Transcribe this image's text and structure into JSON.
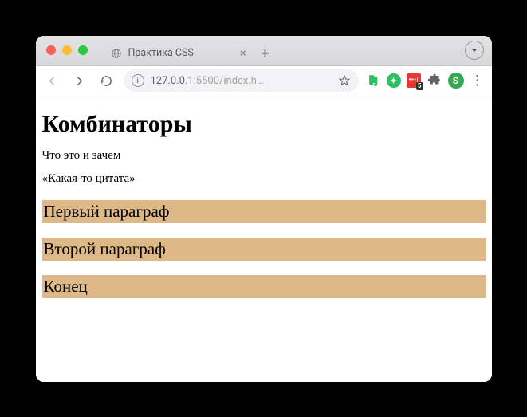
{
  "app": {
    "tab_title": "Практика CSS",
    "url_host": "127.0.0.1",
    "url_port_path": ":5500/index.h…",
    "ext_red_badge": "5",
    "ext_s_letter": "S",
    "site_info_glyph": "i"
  },
  "page": {
    "heading": "Комбинаторы",
    "intro": "Что это и зачем",
    "quote": "«Какая-то цитата»",
    "para1": "Первый параграф",
    "para2": "Второй параграф",
    "para3": "Конец"
  }
}
